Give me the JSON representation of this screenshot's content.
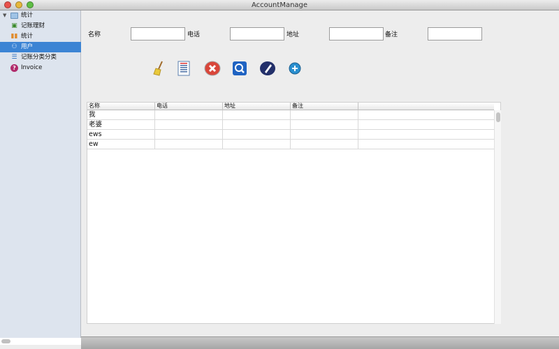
{
  "window": {
    "title": "AccountManage"
  },
  "sidebar": {
    "items": [
      {
        "label": "统计",
        "icon": "folder-icon"
      },
      {
        "label": "记账理财",
        "icon": "money-icon"
      },
      {
        "label": "统计",
        "icon": "bar-chart-icon"
      },
      {
        "label": "用户",
        "icon": "users-icon",
        "selected": true
      },
      {
        "label": "记账分类分类",
        "icon": "list-icon"
      },
      {
        "label": "Invoice",
        "icon": "help-icon"
      }
    ]
  },
  "form": {
    "name_label": "名称",
    "phone_label": "电话",
    "address_label": "地址",
    "note_label": "备注",
    "name_value": "",
    "phone_value": "",
    "address_value": "",
    "note_value": ""
  },
  "toolbar": {
    "icons": [
      "broom-icon",
      "document-icon",
      "delete-icon",
      "search-icon",
      "edit-icon",
      "add-icon"
    ]
  },
  "table": {
    "columns": [
      "名称",
      "电话",
      "地址",
      "备注",
      ""
    ],
    "rows": [
      [
        "我",
        "",
        "",
        "",
        ""
      ],
      [
        "老婆",
        "",
        "",
        "",
        ""
      ],
      [
        "ews",
        "",
        "",
        "",
        ""
      ],
      [
        "ew",
        "",
        "",
        "",
        ""
      ]
    ]
  }
}
